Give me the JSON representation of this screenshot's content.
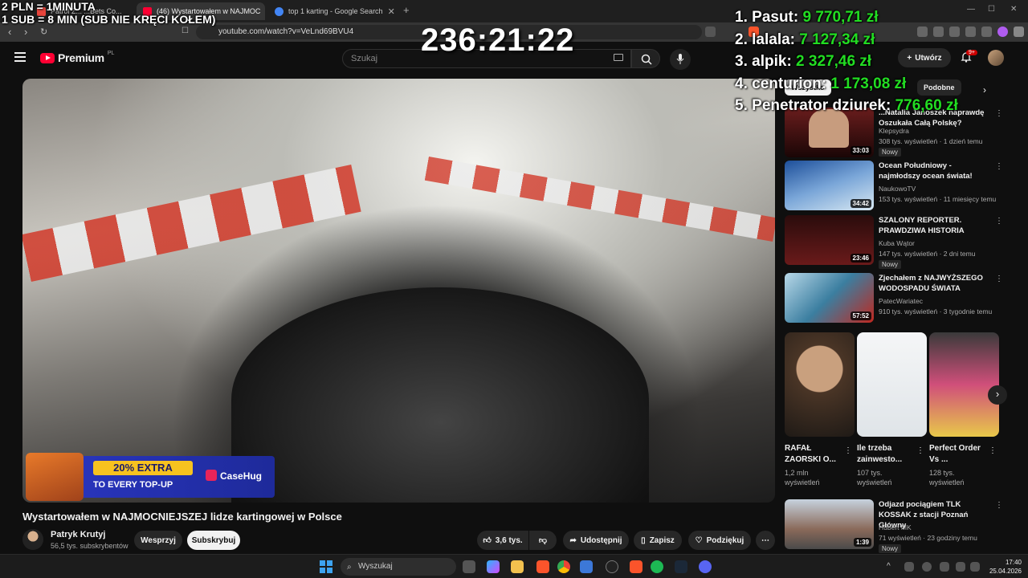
{
  "browser": {
    "tabs": [
      {
        "label": "Patrol Z... ...Bets Co...",
        "color": "#e8453c"
      },
      {
        "label": "(46) Wystartowałem w NAJMOC",
        "color": "#ff0033"
      },
      {
        "label": "top 1 karting - Google Search",
        "color": "#4285f4"
      }
    ],
    "new_tab": "+",
    "url": "youtube.com/watch?v=VeLnd69BVU4"
  },
  "overlay": {
    "line1": "2 PLN =  1MINUTA",
    "line2": "1 SUB = 8 MIN (SUB NIE KRĘCI KOŁEM)",
    "timer": "236:21:22",
    "leaderboard": [
      {
        "rank": "1.",
        "name": "Pasut:",
        "amount": "9 770,71 zł"
      },
      {
        "rank": "2.",
        "name": "lalala:",
        "amount": "7 127,34 zł"
      },
      {
        "rank": "3.",
        "name": "alpik:",
        "amount": "2 327,46 zł"
      },
      {
        "rank": "4.",
        "name": "centurion:",
        "amount": "1 173,08 zł"
      },
      {
        "rank": "5.",
        "name": "Penetrator dziurek:",
        "amount": "776,60 zł"
      }
    ]
  },
  "youtube": {
    "logo_text": "Premium",
    "logo_region": "PL",
    "search_placeholder": "Szukaj",
    "create_label": "Utwórz",
    "notif_count": "9+"
  },
  "video": {
    "ad": {
      "pill": "20% EXTRA",
      "line2": "TO EVERY TOP-UP",
      "brand": "CaseHug"
    },
    "title": "Wystartowałem w NAJMOCNIEJSZEJ lidze kartingowej w Polsce",
    "channel": "Patryk Krutyj",
    "subs": "56,5 tys. subskrybentów",
    "support_label": "Wesprzyj",
    "subscribe_label": "Subskrybuj",
    "likes": "3,6 tys.",
    "share_label": "Udostępnij",
    "save_label": "Zapisz",
    "thanks_label": "Podziękuj",
    "more": "⋯"
  },
  "sidebar": {
    "chips": [
      "Wszystko",
      "Podobne"
    ],
    "recs": [
      {
        "title": "...Natalia Janoszek naprawdę Oszukała Całą Polskę?",
        "channel": "Klepsydra",
        "meta": "308 tys. wyświetleń · 1 dzień temu",
        "badge": "Nowy",
        "duration": "33:03",
        "thumb_color": "#a33a2a"
      },
      {
        "title": "Ocean Południowy - najmłodszy ocean świata!",
        "channel": "NaukowoTV",
        "meta": "153 tys. wyświetleń · 11 miesięcy temu",
        "badge": "",
        "duration": "34:42",
        "thumb_color": "#3a6fb0"
      },
      {
        "title": "SZALONY REPORTER. PRAWDZIWA HISTORIA",
        "channel": "Kuba Wątor",
        "meta": "147 tys. wyświetleń · 2 dni temu",
        "badge": "Nowy",
        "duration": "23:46",
        "thumb_color": "#5a1f1f"
      },
      {
        "title": "Zjechałem z NAJWYŻSZEGO WODOSPADU ŚWIATA",
        "channel": "PatecWariatec",
        "meta": "910 tys. wyświetleń · 3 tygodnie temu",
        "badge": "",
        "duration": "57:52",
        "thumb_color": "#2c6f8f"
      },
      {
        "title": "Odjazd pociągiem TLK KOSSAK z stacji Poznań Główny",
        "channel": "Hubert MK",
        "meta": "71 wyświetleń · 23 godziny temu",
        "badge": "Nowy",
        "duration": "1:39",
        "thumb_color": "#7a8aa0"
      }
    ],
    "shorts": [
      {
        "title": "RAFAŁ ZAORSKI O...",
        "views": "1,2 mln wyświetleń",
        "thumb_color": "#8a6a50"
      },
      {
        "title": "Ile trzeba zainwesto...",
        "views": "107 tys. wyświetleń",
        "thumb_color": "#e6e8ea"
      },
      {
        "title": "Perfect Order Vs ...",
        "views": "128 tys. wyświetleń",
        "thumb_color": "#c86a8a"
      }
    ]
  },
  "taskbar": {
    "search_label": "Wyszukaj",
    "time": "17:40",
    "date": "25.04.2026"
  }
}
